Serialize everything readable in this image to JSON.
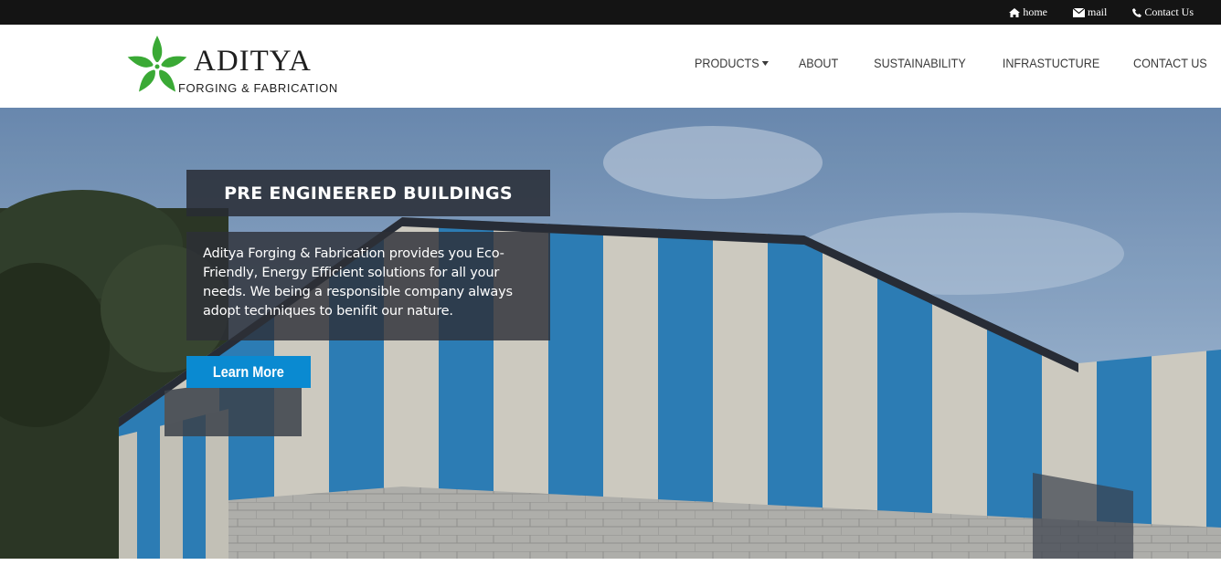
{
  "topbar": {
    "links": [
      {
        "label": "home",
        "icon": "home-icon"
      },
      {
        "label": "mail",
        "icon": "envelope-icon"
      },
      {
        "label": "Contact Us",
        "icon": "phone-icon"
      }
    ]
  },
  "brand": {
    "title": "ADITYA",
    "subtitle": "FORGING & FABRICATION",
    "logo_icon": "green-star-flower-icon",
    "logo_color": "#3aa935"
  },
  "nav": {
    "items": [
      {
        "label": "PRODUCTS",
        "has_dropdown": true
      },
      {
        "label": "ABOUT"
      },
      {
        "label": "SUSTAINABILITY"
      },
      {
        "label": "INFRASTUCTURE"
      },
      {
        "label": "CONTACT US"
      }
    ]
  },
  "hero": {
    "title": "PRE ENGINEERED BUILDINGS",
    "description": "Aditya Forging & Fabrication provides you Eco-Friendly, Energy Efficient solutions for all your needs. We being a responsible company always adopt techniques to benifit our nature.",
    "cta_label": "Learn More",
    "cta_color": "#0a8ad1"
  }
}
